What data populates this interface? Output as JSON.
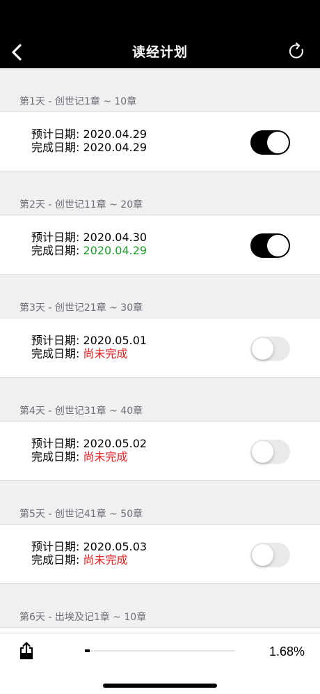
{
  "nav": {
    "title": "读经计划",
    "back_icon": "chevron-left-icon",
    "refresh_icon": "refresh-icon"
  },
  "days": [
    {
      "header": "第1天 - 创世记1章 ~ 10章",
      "planned": "预计日期: 2020.04.29",
      "done_label": "完成日期: ",
      "done_value": "2020.04.29",
      "done_status": "normal",
      "completed": true
    },
    {
      "header": "第2天 - 创世记11章 ~ 20章",
      "planned": "预计日期: 2020.04.30",
      "done_label": "完成日期: ",
      "done_value": "2020.04.29",
      "done_status": "early",
      "completed": true
    },
    {
      "header": "第3天 - 创世记21章 ~ 30章",
      "planned": "预计日期: 2020.05.01",
      "done_label": "完成日期: ",
      "done_value": "尚未完成",
      "done_status": "pending",
      "completed": false
    },
    {
      "header": "第4天 - 创世记31章 ~ 40章",
      "planned": "预计日期: 2020.05.02",
      "done_label": "完成日期: ",
      "done_value": "尚未完成",
      "done_status": "pending",
      "completed": false
    },
    {
      "header": "第5天 - 创世记41章 ~ 50章",
      "planned": "预计日期: 2020.05.03",
      "done_label": "完成日期: ",
      "done_value": "尚未完成",
      "done_status": "pending",
      "completed": false
    },
    {
      "header": "第6天 - 出埃及记1章 ~ 10章"
    }
  ],
  "footer": {
    "share_icon": "share-icon",
    "progress_fraction": 0.0168,
    "progress_text": "1.68%"
  },
  "colors": {
    "early": "#1f9a2a",
    "pending": "#e61e1e"
  }
}
